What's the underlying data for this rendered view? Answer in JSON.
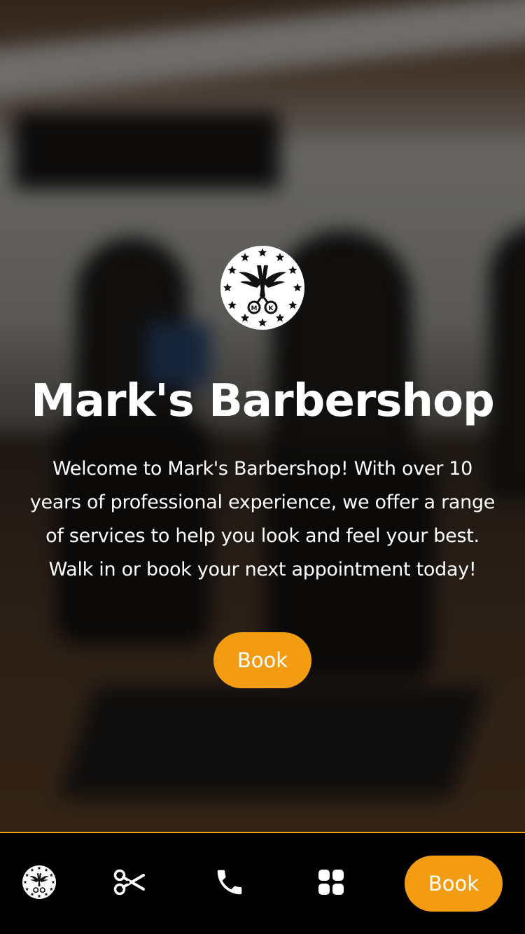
{
  "brand": {
    "name": "Mark's Barbershop",
    "logo_initials": [
      "M",
      "K"
    ],
    "logo_icon": "scissors-wings-stars-icon"
  },
  "hero": {
    "intro_lines": [
      "Welcome to Mark's Barbershop! With over 10",
      "years of professional experience, we offer a range",
      "of services to help you look and feel your best.",
      "Walk in or book your next appointment today!"
    ],
    "book_label": "Book"
  },
  "bottom_nav": {
    "items": [
      {
        "icon": "logo-icon"
      },
      {
        "icon": "scissors-icon"
      },
      {
        "icon": "phone-icon"
      },
      {
        "icon": "grid-icon"
      }
    ],
    "book_label": "Book"
  },
  "colors": {
    "accent": "#f39c12",
    "text": "#ffffff",
    "nav_background": "#000000"
  }
}
